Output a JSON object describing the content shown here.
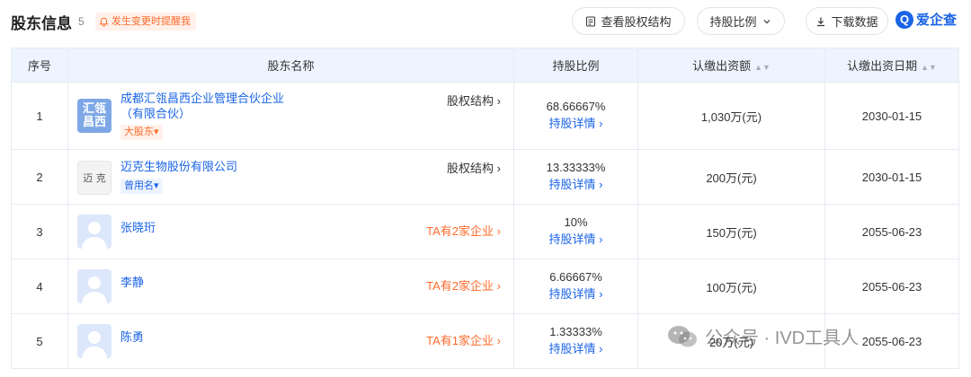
{
  "header": {
    "title": "股东信息",
    "count": "5",
    "alert_label": "发生变更时提醒我",
    "btn_structure": "查看股权结构",
    "btn_ratio": "持股比例",
    "btn_download": "下载数据",
    "brand": "爱企查",
    "brand_logo_letter": "Q"
  },
  "table": {
    "columns": [
      "序号",
      "股东名称",
      "持股比例",
      "认缴出资额",
      "认缴出资日期"
    ],
    "rows": [
      {
        "index": "1",
        "avatar_text": "汇瓴昌西",
        "name": "成都汇瓴昌西企业管理合伙企业（有限合伙）",
        "tag": "大股东",
        "right_link": "股权结构",
        "ratio": "68.66667%",
        "detail": "持股详情",
        "amount": "1,030万(元)",
        "date": "2030-01-15"
      },
      {
        "index": "2",
        "avatar_text": "迈 克",
        "name": "迈克生物股份有限公司",
        "tag": "曾用名",
        "right_link": "股权结构",
        "ratio": "13.33333%",
        "detail": "持股详情",
        "amount": "200万(元)",
        "date": "2030-01-15"
      },
      {
        "index": "3",
        "name": "张晓珩",
        "right_link": "TA有2家企业",
        "ratio": "10%",
        "detail": "持股详情",
        "amount": "150万(元)",
        "date": "2055-06-23"
      },
      {
        "index": "4",
        "name": "李静",
        "right_link": "TA有2家企业",
        "ratio": "6.66667%",
        "detail": "持股详情",
        "amount": "100万(元)",
        "date": "2055-06-23"
      },
      {
        "index": "5",
        "name": "陈勇",
        "right_link": "TA有1家企业",
        "ratio": "1.33333%",
        "detail": "持股详情",
        "amount": "20万(元)",
        "date": "2055-06-23"
      }
    ]
  },
  "watermark": {
    "text": "公众号 · IVD工具人"
  },
  "colors": {
    "accent_blue": "#1a64e6",
    "accent_orange": "#ff6a2b",
    "header_bg": "#eef4ff"
  }
}
